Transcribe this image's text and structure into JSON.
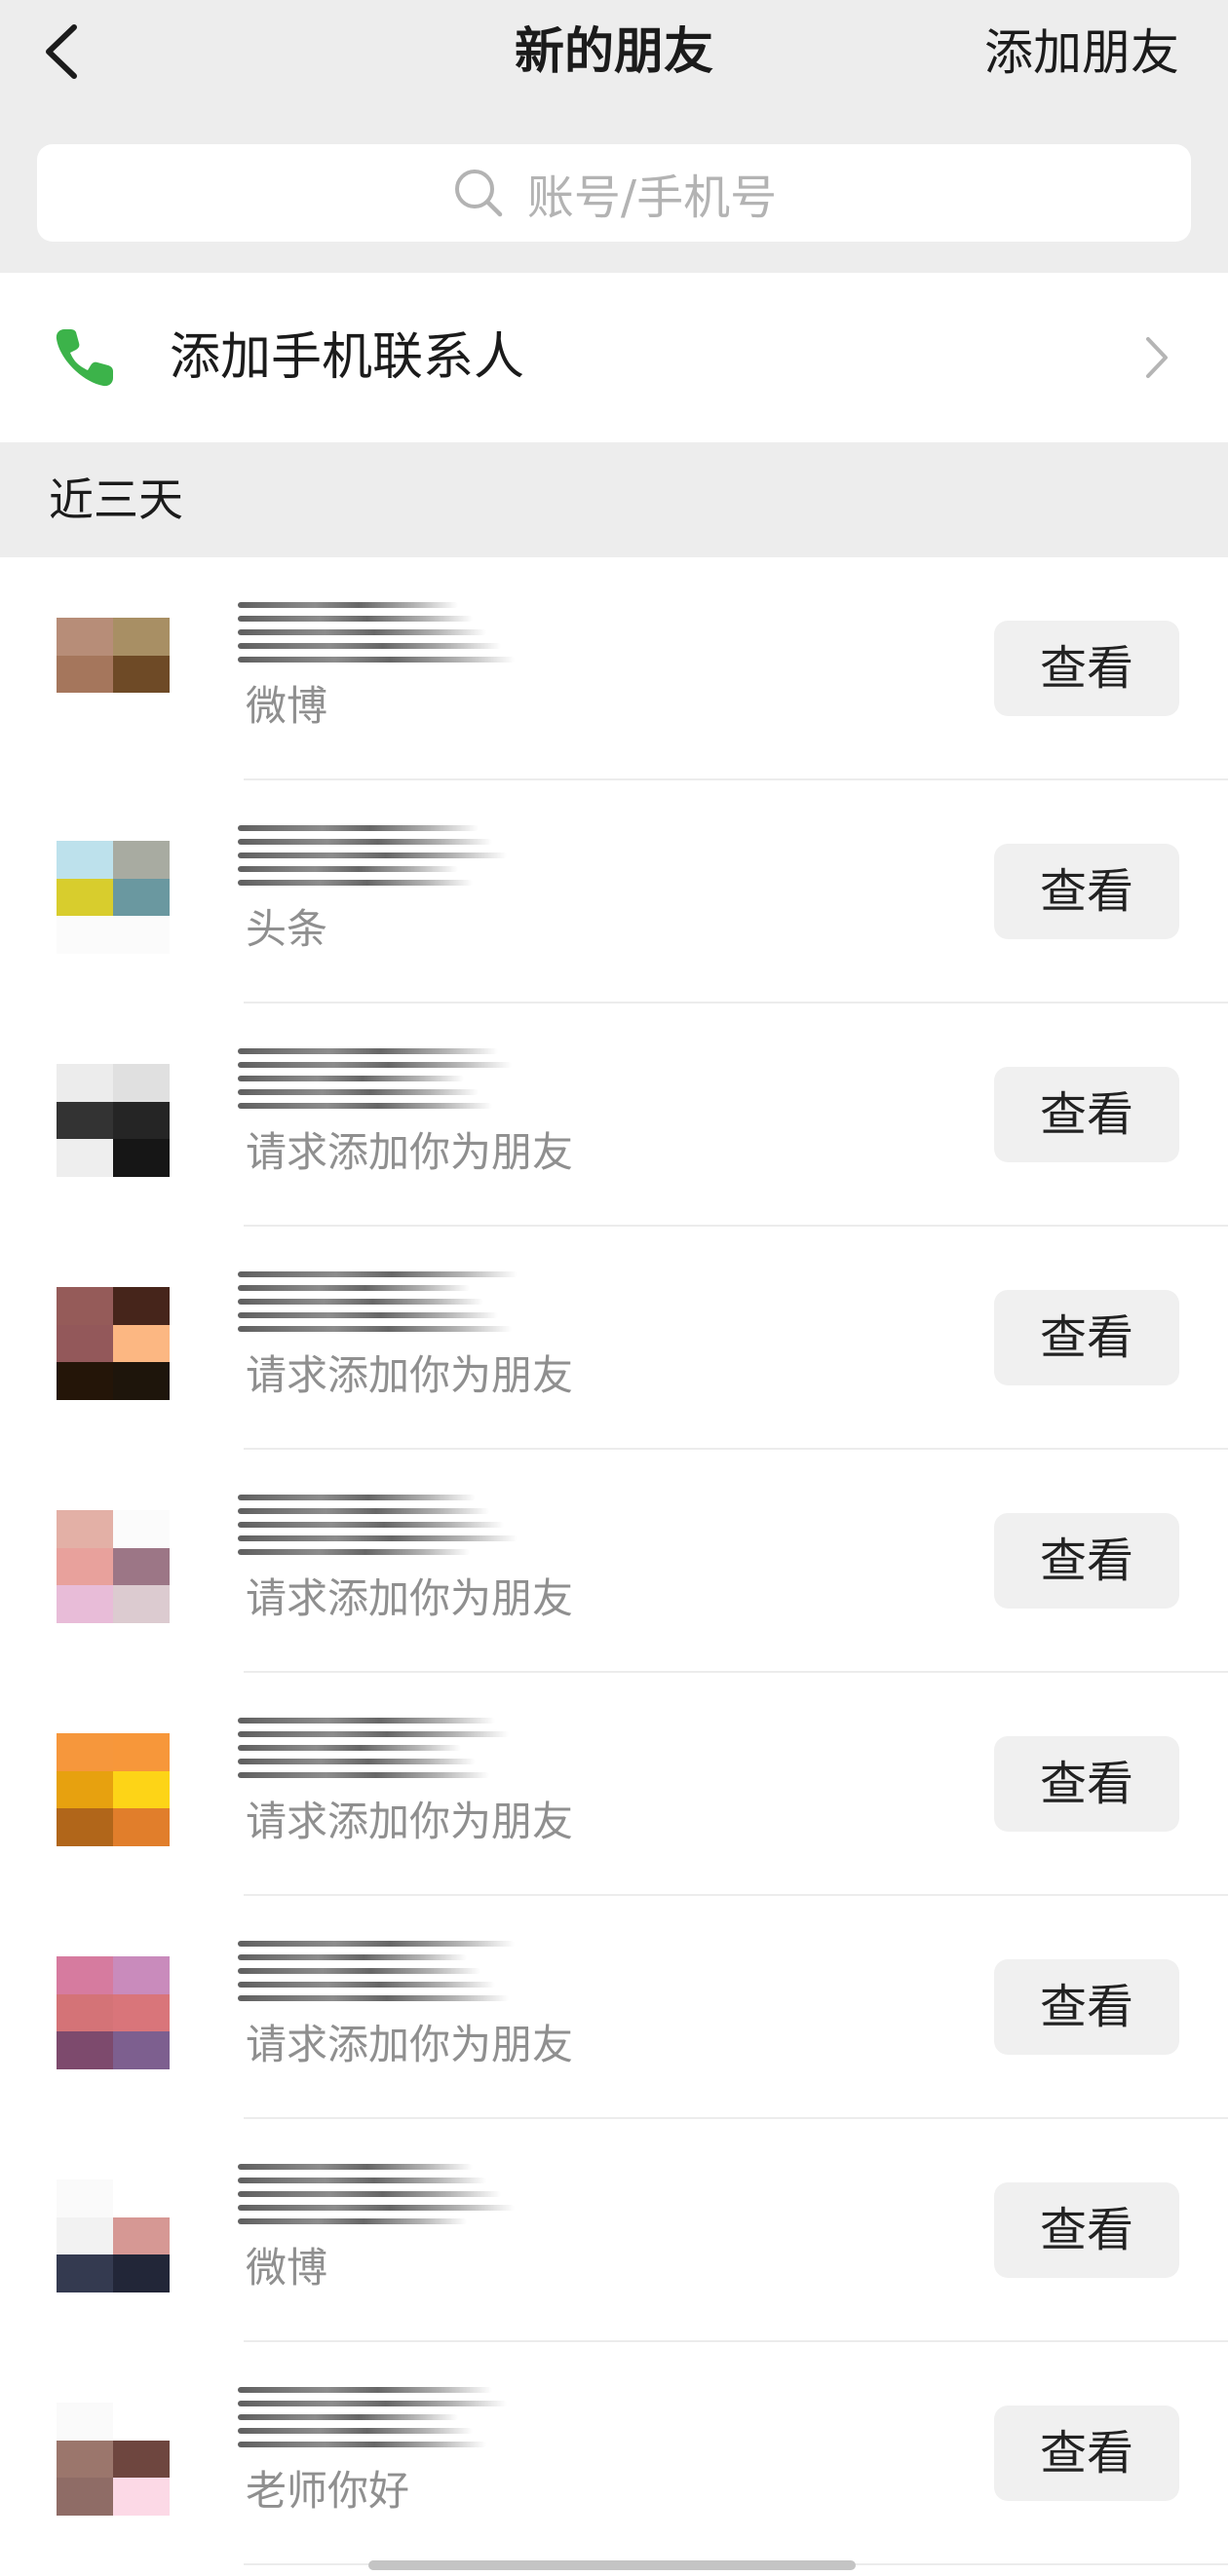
{
  "header": {
    "title": "新的朋友",
    "add_friend": "添加朋友"
  },
  "search": {
    "placeholder": "账号/手机号"
  },
  "phone_contacts": {
    "label": "添加手机联系人"
  },
  "section": {
    "label": "近三天"
  },
  "colors": {
    "accent_green": "#3cb34a",
    "background_gray": "#ededed",
    "button_gray": "#f0f0f0",
    "subtitle_gray": "#8f8f8f"
  },
  "requests": [
    {
      "subtitle": "微博",
      "button": "查看",
      "avatar_colors": [
        "#b78d78",
        "#a88f64",
        "#a5765c",
        "#6e4a26",
        "#ffffff",
        "#ffffff"
      ]
    },
    {
      "subtitle": "头条",
      "button": "查看",
      "avatar_colors": [
        "#bde1ec",
        "#a8aba1",
        "#d8cd2d",
        "#6a98a0",
        "#fbfbfb",
        "#fbfbfb"
      ]
    },
    {
      "subtitle": "请求添加你为朋友",
      "button": "查看",
      "avatar_colors": [
        "#ececec",
        "#e0e0e0",
        "#333333",
        "#252525",
        "#eeeeee",
        "#161616"
      ]
    },
    {
      "subtitle": "请求添加你为朋友",
      "button": "查看",
      "avatar_colors": [
        "#955b59",
        "#46251b",
        "#93585a",
        "#fcb782",
        "#241508",
        "#1e150b"
      ]
    },
    {
      "subtitle": "请求添加你为朋友",
      "button": "查看",
      "avatar_colors": [
        "#e3b0a6",
        "#fbfbfb",
        "#e8a19c",
        "#9c7686",
        "#e8bcd8",
        "#dccbd0"
      ]
    },
    {
      "subtitle": "请求添加你为朋友",
      "button": "查看",
      "avatar_colors": [
        "#f6973c",
        "#f7973a",
        "#e7a10f",
        "#fdd417",
        "#b1661a",
        "#e17e2b"
      ]
    },
    {
      "subtitle": "请求添加你为朋友",
      "button": "查看",
      "avatar_colors": [
        "#d67b9f",
        "#c98bbc",
        "#d47377",
        "#d9757a",
        "#7d4a6d",
        "#7d5f8f"
      ]
    },
    {
      "subtitle": "微博",
      "button": "查看",
      "avatar_colors": [
        "#fafafa",
        "#ffffff",
        "#f2f2f2",
        "#d69894",
        "#343a50",
        "#222638"
      ]
    },
    {
      "subtitle": "老师你好",
      "button": "查看",
      "avatar_colors": [
        "#fafafa",
        "#ffffff",
        "#9b766c",
        "#6e463f",
        "#8f6c66",
        "#fcd9e6"
      ]
    }
  ]
}
